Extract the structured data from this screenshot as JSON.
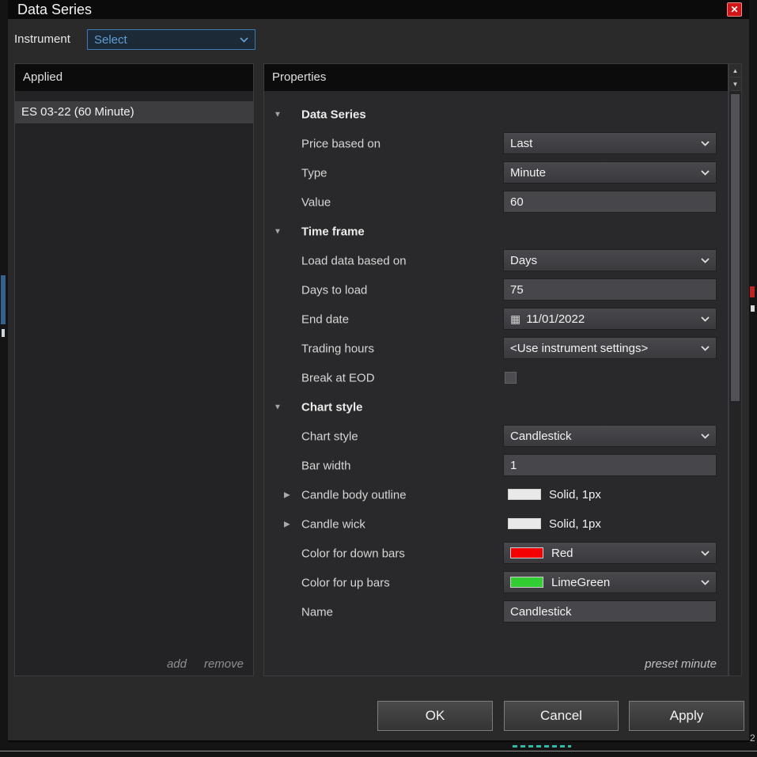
{
  "window": {
    "title": "Data Series",
    "close_icon": "✕"
  },
  "instrument": {
    "label": "Instrument",
    "value": "Select"
  },
  "applied_panel": {
    "header": "Applied",
    "items": [
      {
        "label": "ES 03-22 (60 Minute)"
      }
    ],
    "add_label": "add",
    "remove_label": "remove"
  },
  "properties_panel": {
    "header": "Properties",
    "preset_label": "preset minute",
    "rows": [
      {
        "kind": "section",
        "label": "Data Series"
      },
      {
        "kind": "dropdown",
        "label": "Price based on",
        "value": "Last"
      },
      {
        "kind": "dropdown",
        "label": "Type",
        "value": "Minute"
      },
      {
        "kind": "text",
        "label": "Value",
        "value": "60"
      },
      {
        "kind": "section",
        "label": "Time frame"
      },
      {
        "kind": "dropdown",
        "label": "Load data based on",
        "value": "Days"
      },
      {
        "kind": "text",
        "label": "Days to load",
        "value": "75"
      },
      {
        "kind": "date",
        "label": "End date",
        "value": "11/01/2022",
        "calendar_icon": "▦"
      },
      {
        "kind": "dropdown",
        "label": "Trading hours",
        "value": "<Use instrument settings>"
      },
      {
        "kind": "checkbox",
        "label": "Break at EOD",
        "checked": false
      },
      {
        "kind": "section",
        "label": "Chart style"
      },
      {
        "kind": "dropdown",
        "label": "Chart style",
        "value": "Candlestick"
      },
      {
        "kind": "text",
        "label": "Bar width",
        "value": "1"
      },
      {
        "kind": "swatch",
        "label": "Candle body outline",
        "value": "Solid, 1px",
        "swatch_color": "#e9e9e9"
      },
      {
        "kind": "swatch",
        "label": "Candle wick",
        "value": "Solid, 1px",
        "swatch_color": "#e9e9e9"
      },
      {
        "kind": "colordropdown",
        "label": "Color for down bars",
        "value": "Red",
        "swatch_color": "#f40000"
      },
      {
        "kind": "colordropdown",
        "label": "Color for up bars",
        "value": "LimeGreen",
        "swatch_color": "#32cd32"
      },
      {
        "kind": "text",
        "label": "Name",
        "value": "Candlestick"
      }
    ]
  },
  "buttons": {
    "ok": "OK",
    "cancel": "Cancel",
    "apply": "Apply"
  },
  "background": {
    "price_axis_digit": "2"
  },
  "colors": {
    "dialog_bg": "#2a2a2b",
    "header_bg": "#0c0c0c",
    "accent_blue": "#3c7ab5",
    "down_bar": "#f40000",
    "up_bar": "#32cd32",
    "close_red": "#d21414"
  }
}
